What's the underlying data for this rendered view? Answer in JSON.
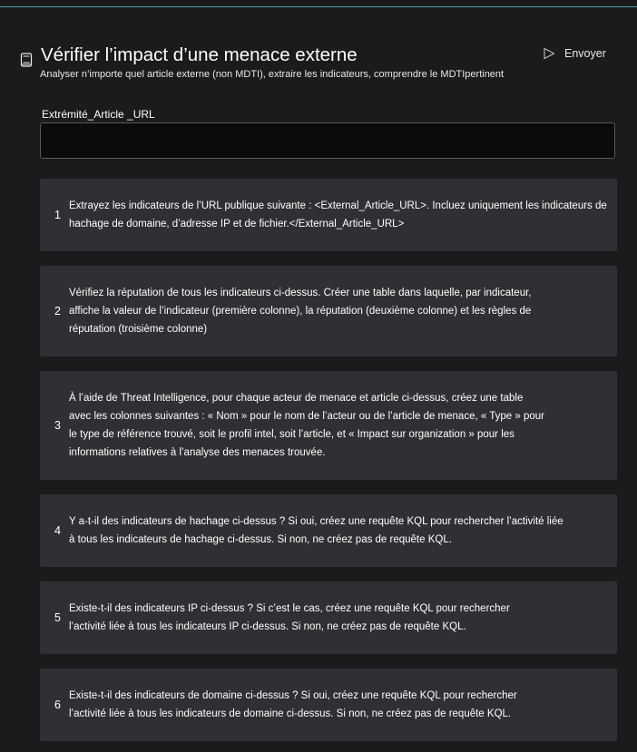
{
  "header": {
    "title": "Vérifier l’impact d’une menace externe",
    "subtitle": "Analyser n’importe quel article externe (non MDTI), extraire les indicateurs, comprendre le MDTIpertinent",
    "send_label": "Envoyer"
  },
  "form": {
    "field_label": "Extrémité_Article _URL",
    "field_value": ""
  },
  "steps": [
    {
      "number": "1",
      "text": "Extrayez les indicateurs de l’URL publique suivante : <External_Article_URL>. Incluez uniquement les indicateurs de hachage de domaine, d’adresse IP et de fichier.</External_Article_URL>"
    },
    {
      "number": "2",
      "text": "Vérifiez la réputation de tous les indicateurs ci-dessus. Créer une table dans laquelle, par indicateur, affiche la valeur de l’indicateur (première colonne), la réputation (deuxième colonne) et les règles de réputation (troisième colonne)"
    },
    {
      "number": "3",
      "text": "À l’aide de Threat Intelligence, pour chaque acteur de menace et article ci-dessus, créez une table avec les colonnes suivantes : « Nom » pour le nom de l’acteur ou de l’article de menace, « Type » pour le type de référence trouvé, soit le profil intel, soit l’article, et « Impact sur organization » pour les informations relatives à l’analyse des menaces trouvée."
    },
    {
      "number": "4",
      "text": "Y a-t-il des indicateurs de hachage ci-dessus ? Si oui, créez une requête KQL pour rechercher l’activité liée à tous les indicateurs de hachage ci-dessus. Si non, ne créez pas de requête KQL."
    },
    {
      "number": "5",
      "text": "Existe-t-il des indicateurs IP ci-dessus ? Si c’est le cas, créez une requête KQL pour rechercher l’activité liée à tous les indicateurs IP ci-dessus. Si non, ne créez pas de requête KQL."
    },
    {
      "number": "6",
      "text": "Existe-t-il des indicateurs de domaine ci-dessus ? Si oui, créez une requête KQL pour rechercher l’activité liée à tous les indicateurs de domaine ci-dessus. Si non, ne créez pas de requête KQL."
    }
  ],
  "icons": {
    "title_icon": "notebook-icon",
    "send_icon": "send-icon"
  }
}
